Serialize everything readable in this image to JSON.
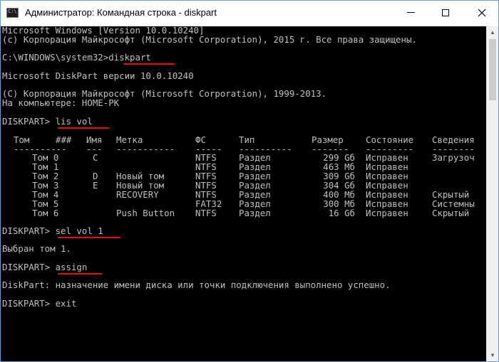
{
  "window": {
    "title": "Администратор: Командная строка - diskpart",
    "icon_label": "C:\\",
    "controls": {
      "minimize": "minimize-icon",
      "maximize": "maximize-icon",
      "close": "close-icon"
    }
  },
  "console": {
    "lines": [
      "Microsoft Windows [Version 10.0.10240]",
      "(c) Корпорация Майкрософт (Microsoft Corporation), 2015 г. Все права защищены.",
      "C:\\WINDOWS\\system32>diskpart",
      "Microsoft DiskPart версии 10.0.10240",
      "(C) Корпорация Майкрософт (Microsoft Corporation), 1999-2013.",
      "На компьютере: HOME-PK",
      "DISKPART> lis vol",
      "DISKPART> sel vol 1",
      "Выбран том 1.",
      "DISKPART> assign",
      "DiskPart: назначение имени диска или точки подключения выполнено успешно.",
      "DISKPART> exit"
    ],
    "volume_table": {
      "headers": [
        "Том",
        "###",
        "Имя",
        "Метка",
        "ФС",
        "Тип",
        "Размер",
        "Состояние",
        "Сведения"
      ],
      "separators": [
        "----------",
        "---",
        "-----------",
        "-----",
        "----------",
        "-------",
        "---------",
        "--------"
      ],
      "rows": [
        [
          "Том 0",
          "C",
          "",
          "NTFS",
          "Раздел",
          "299 Gб",
          "Исправен",
          "Загрузоч"
        ],
        [
          "Том 1",
          "",
          "",
          "NTFS",
          "Раздел",
          "463 Мб",
          "Исправен",
          ""
        ],
        [
          "Том 2",
          "D",
          "Новый том",
          "NTFS",
          "Раздел",
          "309 Gб",
          "Исправен",
          ""
        ],
        [
          "Том 3",
          "E",
          "Новый том",
          "NTFS",
          "Раздел",
          "304 Gб",
          "Исправен",
          ""
        ],
        [
          "Том 4",
          "",
          "RECOVERY",
          "NTFS",
          "Раздел",
          "400 Мб",
          "Исправен",
          "Скрытый"
        ],
        [
          "Том 5",
          "",
          "",
          "FAT32",
          "Раздел",
          "300 Мб",
          "Исправен",
          "Системны"
        ],
        [
          "Том 6",
          "",
          "Push Button",
          "NTFS",
          "Раздел",
          "16 Gб",
          "Исправен",
          "Скрытый"
        ]
      ]
    },
    "colors": {
      "background": "#000000",
      "text": "#c0c0c0",
      "underline": "#e01515"
    }
  }
}
